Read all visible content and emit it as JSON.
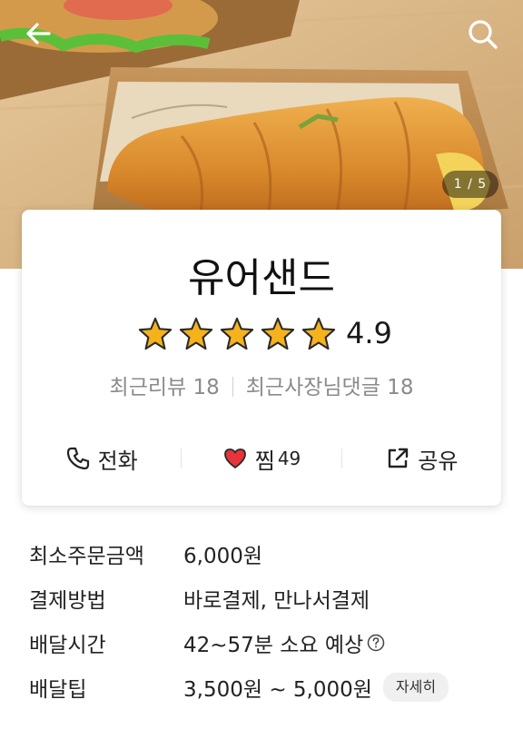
{
  "hero": {
    "counter": "1 / 5",
    "back_icon": "arrow-left-icon",
    "search_icon": "search-icon"
  },
  "store": {
    "name": "유어샌드",
    "rating": "4.9",
    "rating_stars": 5,
    "recent_reviews": "최근리뷰 18",
    "recent_owner_comments": "최근사장님댓글 18"
  },
  "actions": {
    "call_label": "전화",
    "zzim_label": "찜",
    "zzim_count": "49",
    "share_label": "공유"
  },
  "info": {
    "min_order_label": "최소주문금액",
    "min_order_value": "6,000원",
    "payment_label": "결제방법",
    "payment_value": "바로결제, 만나서결제",
    "delivery_time_label": "배달시간",
    "delivery_time_value": "42~57분 소요 예상",
    "delivery_tip_label": "배달팁",
    "delivery_tip_value": "3,500원 ~ 5,000원",
    "detail_button": "자세히"
  },
  "colors": {
    "star": "#f5b21d",
    "heart": "#e8333c",
    "text": "#222222",
    "muted": "#8a8a8a"
  }
}
